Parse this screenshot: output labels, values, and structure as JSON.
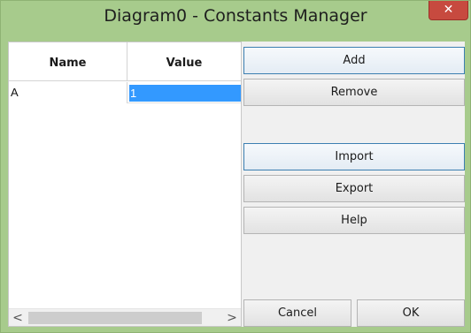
{
  "window": {
    "title": "Diagram0 - Constants Manager",
    "close_glyph": "✕",
    "colors": {
      "frame": "#a7cb8c",
      "close": "#c74a3f",
      "selection": "#3399ff"
    }
  },
  "grid": {
    "columns": [
      "Name",
      "Value"
    ],
    "rows": [
      {
        "name": "A",
        "value": "1"
      }
    ],
    "scroll_left_glyph": "<",
    "scroll_right_glyph": ">"
  },
  "buttons": {
    "add": "Add",
    "remove": "Remove",
    "import": "Import",
    "export": "Export",
    "help": "Help",
    "cancel": "Cancel",
    "ok": "OK"
  }
}
